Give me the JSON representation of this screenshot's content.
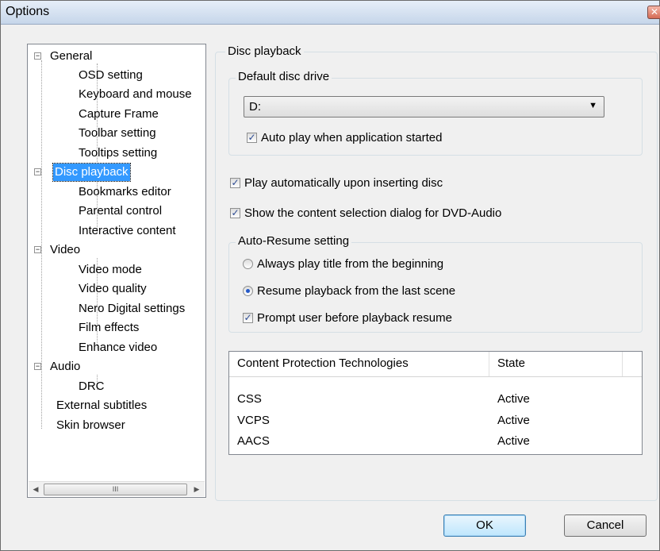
{
  "window": {
    "title": "Options",
    "close_glyph": "✕"
  },
  "tree": {
    "items": [
      {
        "label": "General",
        "expander": "−"
      },
      {
        "label": "OSD setting"
      },
      {
        "label": "Keyboard and mouse"
      },
      {
        "label": "Capture Frame"
      },
      {
        "label": "Toolbar setting"
      },
      {
        "label": "Tooltips setting"
      },
      {
        "label": "Disc playback",
        "expander": "−",
        "selected": true
      },
      {
        "label": "Bookmarks editor"
      },
      {
        "label": "Parental control"
      },
      {
        "label": "Interactive content"
      },
      {
        "label": "Video",
        "expander": "−"
      },
      {
        "label": "Video mode"
      },
      {
        "label": "Video quality"
      },
      {
        "label": "Nero Digital settings"
      },
      {
        "label": "Film effects"
      },
      {
        "label": "Enhance video"
      },
      {
        "label": "Audio",
        "expander": "−"
      },
      {
        "label": "DRC"
      },
      {
        "label": "External subtitles"
      },
      {
        "label": "Skin browser"
      }
    ],
    "scroll_left": "◀",
    "scroll_right": "▶",
    "scroll_grip": "III"
  },
  "panel": {
    "title": "Disc playback",
    "default_drive": {
      "group_title": "Default disc drive",
      "selected_drive": "D:",
      "arrow": "▼",
      "auto_play_label": "Auto play when application started",
      "auto_play_checked": true
    },
    "play_auto_insert_label": "Play automatically upon inserting disc",
    "play_auto_insert_checked": true,
    "show_selection_dialog_label": "Show the content selection dialog for DVD-Audio",
    "show_selection_dialog_checked": true,
    "auto_resume": {
      "group_title": "Auto-Resume setting",
      "options": [
        {
          "label": "Always play title from the beginning",
          "selected": false
        },
        {
          "label": "Resume playback from the last scene",
          "selected": true
        }
      ],
      "prompt_label": "Prompt user before playback resume",
      "prompt_checked": true
    },
    "protection_table": {
      "columns": [
        "Content Protection Technologies",
        "State"
      ],
      "rows": [
        {
          "tech": "CSS",
          "state": "Active"
        },
        {
          "tech": "VCPS",
          "state": "Active"
        },
        {
          "tech": "AACS",
          "state": "Active"
        }
      ]
    }
  },
  "buttons": {
    "ok": "OK",
    "cancel": "Cancel"
  },
  "check_glyph": "✓"
}
